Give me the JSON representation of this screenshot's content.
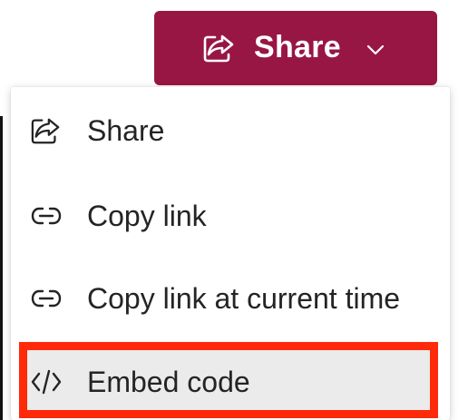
{
  "share_button": {
    "label": "Share",
    "icon": "share-icon",
    "chevron_icon": "chevron-down-icon",
    "background_color": "#981643"
  },
  "menu": {
    "items": [
      {
        "label": "Share",
        "icon": "share-icon"
      },
      {
        "label": "Copy link",
        "icon": "link-icon"
      },
      {
        "label": "Copy link at current time",
        "icon": "link-icon"
      },
      {
        "label": "Embed code",
        "icon": "code-icon",
        "highlighted": true
      }
    ],
    "highlight_color": "#ff2a0a"
  }
}
